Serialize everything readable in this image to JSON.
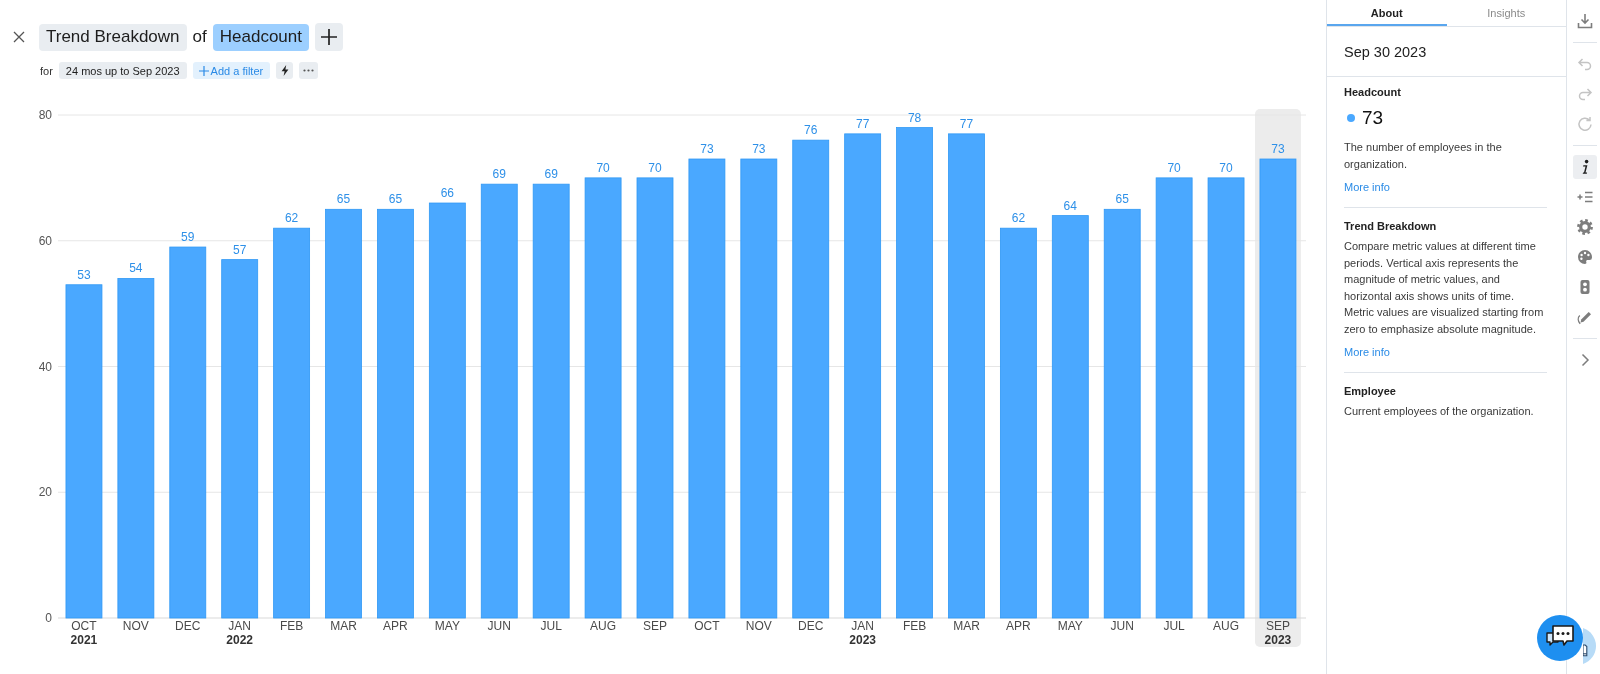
{
  "header": {
    "analysis": "Trend Breakdown",
    "connector": "of",
    "metric": "Headcount",
    "for_label": "for",
    "period": "24 mos up to Sep 2023",
    "add_filter": "Add a filter"
  },
  "chart": {
    "chart_data": {
      "type": "bar",
      "categories": [
        "OCT\n2021",
        "NOV",
        "DEC",
        "JAN\n2022",
        "FEB",
        "MAR",
        "APR",
        "MAY",
        "JUN",
        "JUL",
        "AUG",
        "SEP",
        "OCT",
        "NOV",
        "DEC",
        "JAN\n2023",
        "FEB",
        "MAR",
        "APR",
        "MAY",
        "JUN",
        "JUL",
        "AUG",
        "SEP\n2023"
      ],
      "values": [
        53,
        54,
        59,
        57,
        62,
        65,
        65,
        66,
        69,
        69,
        70,
        70,
        73,
        73,
        76,
        77,
        78,
        77,
        62,
        64,
        65,
        70,
        70,
        73
      ],
      "ylim": [
        0,
        80
      ],
      "yticks": [
        0,
        20,
        40,
        60,
        80
      ],
      "grid": true,
      "data_labels": true,
      "bands": [
        {
          "axis": "x",
          "from": "SEP\n2023",
          "to": "SEP\n2023",
          "color": "#ececec"
        }
      ]
    }
  },
  "panel": {
    "tabs": [
      {
        "label": "About",
        "selected": true
      },
      {
        "label": "Insights",
        "selected": false
      }
    ],
    "date": "Sep 30 2023",
    "sections": [
      {
        "kind": "metric",
        "title": "Headcount",
        "value": "73",
        "description": "The number of employees in the organization.",
        "link": "More info"
      },
      {
        "kind": "info",
        "title": "Trend Breakdown",
        "description": "Compare metric values at different time periods. Vertical axis represents the magnitude of metric values, and horizontal axis shows units of time. Metric values are visualized starting from zero to emphasize absolute magnitude.",
        "link": "More info"
      },
      {
        "kind": "info",
        "title": "Employee",
        "description": "Current employees of the organization."
      }
    ]
  },
  "toolbar": {
    "groups": [
      {
        "items": [
          {
            "kind": "download",
            "selected": false,
            "disabled": false
          }
        ]
      },
      {
        "items": [
          {
            "kind": "undo",
            "selected": false,
            "disabled": true
          },
          {
            "kind": "redo",
            "selected": false,
            "disabled": true
          },
          {
            "kind": "reload",
            "selected": false,
            "disabled": true
          }
        ]
      },
      {
        "items": [
          {
            "kind": "info",
            "selected": true,
            "disabled": false
          },
          {
            "kind": "addlist",
            "selected": false,
            "disabled": false
          },
          {
            "kind": "settings",
            "selected": false,
            "disabled": false
          },
          {
            "kind": "palette",
            "selected": false,
            "disabled": false
          },
          {
            "kind": "device",
            "selected": false,
            "disabled": false
          },
          {
            "kind": "edit",
            "selected": false,
            "disabled": false
          }
        ]
      },
      {
        "items": [
          {
            "kind": "expand",
            "selected": false,
            "disabled": false
          }
        ]
      }
    ]
  }
}
